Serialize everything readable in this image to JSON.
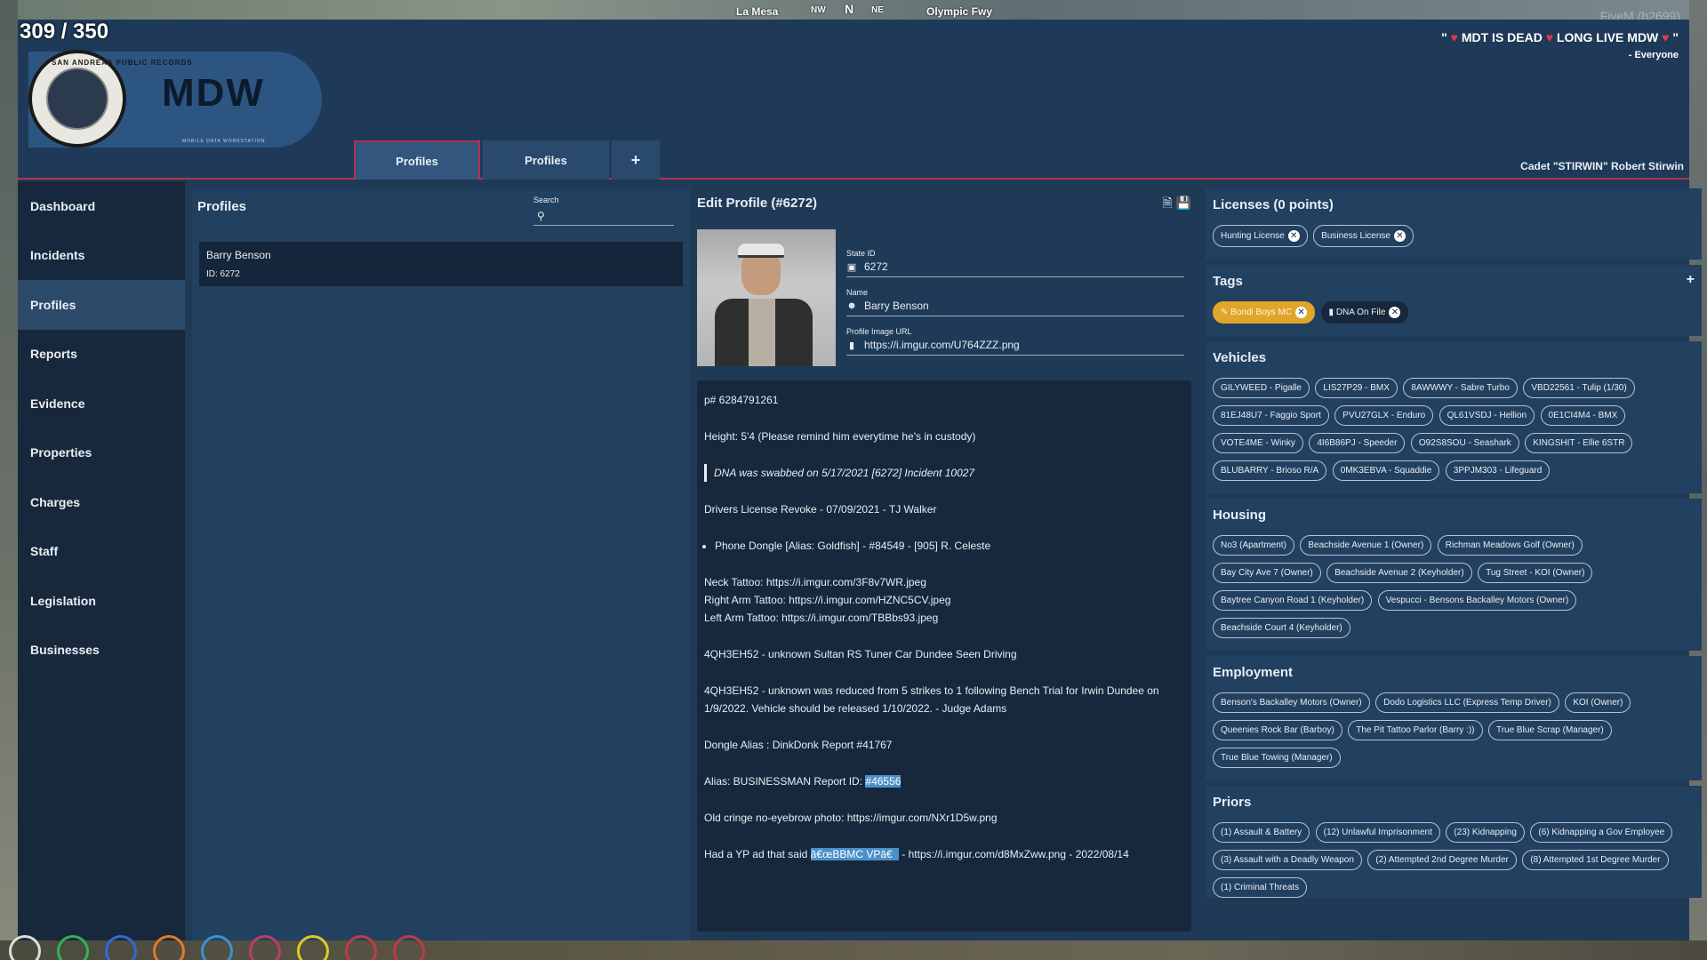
{
  "hud": {
    "counter": "309 / 350",
    "streets": [
      "La Mesa",
      "NW",
      "N",
      "NE",
      "Olympic Fwy"
    ],
    "fivem": "FiveM (b2699)"
  },
  "header": {
    "logo_title": "MDW",
    "logo_sub": "MOBILE DATA WORKSTATION",
    "seal_text": "SAN ANDREAS PUBLIC RECORDS",
    "banner_main": "MDT IS DEAD",
    "banner_main2": "LONG LIVE MDW",
    "banner_sub": "- Everyone",
    "user": "Cadet \"STIRWIN\" Robert Stirwin",
    "tabs": [
      {
        "label": "Profiles"
      },
      {
        "label": "Profiles"
      }
    ],
    "add_tab": "+"
  },
  "sidebar": {
    "items": [
      {
        "label": "Dashboard"
      },
      {
        "label": "Incidents"
      },
      {
        "label": "Profiles"
      },
      {
        "label": "Reports"
      },
      {
        "label": "Evidence"
      },
      {
        "label": "Properties"
      },
      {
        "label": "Charges"
      },
      {
        "label": "Staff"
      },
      {
        "label": "Legislation"
      },
      {
        "label": "Businesses"
      }
    ]
  },
  "profiles": {
    "title": "Profiles",
    "search_label": "Search",
    "results": [
      {
        "name": "Barry Benson",
        "id": "ID: 6272"
      }
    ]
  },
  "edit": {
    "title": "Edit Profile (#6272)",
    "state_id_label": "State ID",
    "state_id": "6272",
    "name_label": "Name",
    "name": "Barry Benson",
    "image_label": "Profile Image URL",
    "image_url": "https://i.imgur.com/U764ZZZ.png",
    "notes": {
      "phone": "p# 6284791261",
      "height": "Height: 5'4 (Please remind him everytime he's in custody)",
      "dna": "DNA was swabbed on 5/17/2021 [6272] Incident 10027",
      "license": "Drivers License Revoke - 07/09/2021 - TJ Walker",
      "dongle": "Phone Dongle [Alias: Goldfish] - #84549 - [905] R. Celeste",
      "tattoo1": "Neck Tattoo: https://i.imgur.com/3F8v7WR.jpeg",
      "tattoo2": "Right Arm Tattoo: https://i.imgur.com/HZNC5CV.jpeg",
      "tattoo3": "Left Arm Tattoo: https://i.imgur.com/TBBbs93.jpeg",
      "car1": "4QH3EH52 - unknown Sultan RS Tuner Car Dundee Seen Driving",
      "car2": "4QH3EH52 - unknown was reduced from 5 strikes to 1 following Bench Trial for Irwin Dundee on 1/9/2022. Vehicle should be released 1/10/2022. - Judge Adams",
      "dongle_alias": "Dongle Alias : DinkDonk  Report #41767",
      "alias_prefix": "Alias: BUSINESSMAN Report ID: ",
      "alias_id": "#46556",
      "photo": "Old cringe no-eyebrow photo:  https://imgur.com/NXr1D5w.png",
      "yp_prefix": "Had a YP ad that said ",
      "yp_hl": "â€œBBMC VPâ€",
      "yp_suffix": " - https://i.imgur.com/d8MxZww.png - 2022/08/14"
    }
  },
  "licenses": {
    "title": "Licenses (0 points)",
    "items": [
      "Hunting License",
      "Business License"
    ]
  },
  "tags": {
    "title": "Tags",
    "items": [
      "Bondi Boys MC",
      "DNA On File"
    ]
  },
  "vehicles": {
    "title": "Vehicles",
    "items": [
      "GILYWEED - Pigalle",
      "LIS27P29 - BMX",
      "8AWWWY - Sabre Turbo",
      "VBD22561 - Tulip (1/30)",
      "81EJ48U7 - Faggio Sport",
      "PVU27GLX - Enduro",
      "QL61VSDJ - Hellion",
      "0E1CI4M4 - BMX",
      "VOTE4ME - Winky",
      "4I6B86PJ - Speeder",
      "O92S8SOU - Seashark",
      "KINGSHIT - Ellie 6STR",
      "BLUBARRY - Brioso R/A",
      "0MK3EBVA - Squaddie",
      "3PPJM303 - Lifeguard"
    ]
  },
  "housing": {
    "title": "Housing",
    "items": [
      "No3 (Apartment)",
      "Beachside Avenue 1 (Owner)",
      "Richman Meadows Golf (Owner)",
      "Bay City Ave 7 (Owner)",
      "Beachside Avenue 2 (Keyholder)",
      "Tug Street - KOI (Owner)",
      "Baytree Canyon Road 1 (Keyholder)",
      "Vespucci - Bensons Backalley Motors (Owner)",
      "Beachside Court 4 (Keyholder)"
    ]
  },
  "employment": {
    "title": "Employment",
    "items": [
      "Benson's Backalley Motors (Owner)",
      "Dodo Logistics LLC (Express Temp Driver)",
      "KOI (Owner)",
      "Queenies Rock Bar (Barboy)",
      "The Pit Tattoo Parlor (Barry :))",
      "True Blue Scrap (Manager)",
      "True Blue Towing (Manager)"
    ]
  },
  "priors": {
    "title": "Priors",
    "items": [
      "(1) Assault & Battery",
      "(12) Unlawful Imprisonment",
      "(23) Kidnapping",
      "(6) Kidnapping a Gov Employee",
      "(3) Assault with a Deadly Weapon",
      "(2) Attempted 2nd Degree Murder",
      "(8) Attempted 1st Degree Murder",
      "(1) Criminal Threats"
    ]
  }
}
